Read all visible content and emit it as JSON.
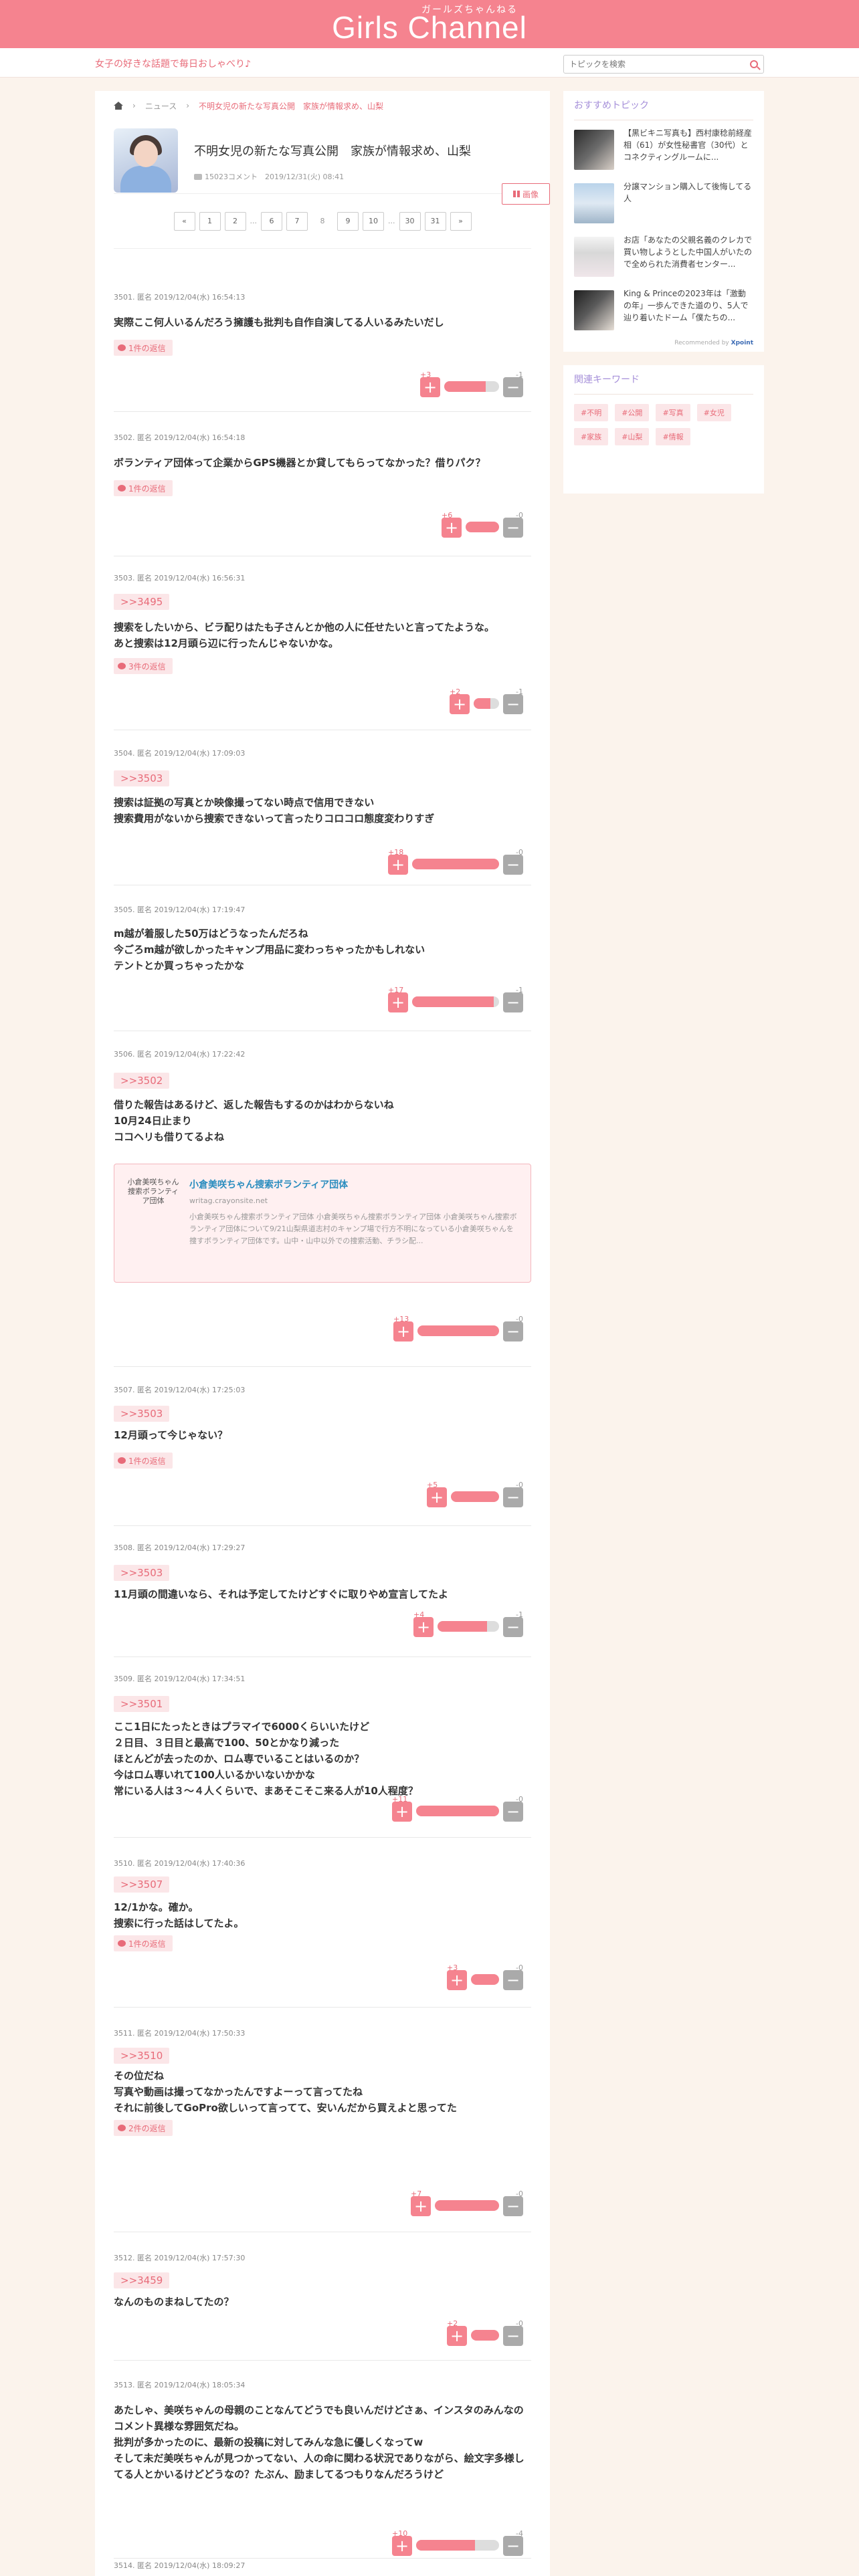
{
  "header": {
    "logo": "Girls Channel",
    "logo_sub": "ガールズちゃんねる"
  },
  "subbar": {
    "tagline": "女子の好きな話題で毎日おしゃべり♪",
    "search_placeholder": "トピックを検索"
  },
  "breadcrumb": {
    "news": "ニュース",
    "current": "不明女児の新たな写真公開　家族が情報求め、山梨"
  },
  "article": {
    "title": "不明女児の新たな写真公開　家族が情報求め、山梨",
    "comments": "15023コメント",
    "date": "2019/12/31(火) 08:41",
    "fav_label": "画像"
  },
  "pager": {
    "prev": "«",
    "next": "»",
    "pages": [
      "1",
      "2",
      "6",
      "7",
      "8",
      "9",
      "10",
      "30",
      "31"
    ],
    "dots": "..."
  },
  "comments": [
    {
      "meta": "3501. 匿名 2019/12/04(水) 16:54:13",
      "anchor": "",
      "body": "実際ここ何人いるんだろう擁護も批判も自作自演してる人いるみたいだし",
      "reply": "1件の返信",
      "plus": "+3",
      "minus": "-1",
      "ratio": 0.75
    },
    {
      "meta": "3502. 匿名 2019/12/04(水) 16:54:18",
      "anchor": "",
      "body": "ボランティア団体って企業からGPS機器とか貸してもらってなかった？借りパク？",
      "reply": "1件の返信",
      "plus": "+6",
      "minus": "-0",
      "ratio": 1
    },
    {
      "meta": "3503. 匿名 2019/12/04(水) 16:56:31",
      "anchor": ">>3495",
      "body": "捜索をしたいから、ビラ配りはたも子さんとか他の人に任せたいと言ってたような。\nあと捜索は12月頭ら辺に行ったんじゃないかな。",
      "reply": "3件の返信",
      "plus": "+2",
      "minus": "-1",
      "ratio": 0.67
    },
    {
      "meta": "3504. 匿名 2019/12/04(水) 17:09:03",
      "anchor": ">>3503",
      "body": "捜索は証拠の写真とか映像撮ってない時点で信用できない\n捜索費用がないから捜索できないって言ったりコロコロ態度変わりすぎ",
      "reply": "",
      "plus": "+18",
      "minus": "-0",
      "ratio": 1
    },
    {
      "meta": "3505. 匿名 2019/12/04(水) 17:19:47",
      "anchor": "",
      "body": "m越が着服した50万はどうなったんだろね\n今ごろm越が欲しかったキャンプ用品に変わっちゃったかもしれない\nテントとか買っちゃったかな",
      "reply": "",
      "plus": "+17",
      "minus": "-1",
      "ratio": 0.94
    },
    {
      "meta": "3506. 匿名 2019/12/04(水) 17:22:42",
      "anchor": ">>3502",
      "body": "借りた報告はあるけど、返した報告もするのかはわからないね\n10月24日止まり\nココヘリも借りてるよね",
      "reply": "",
      "plus": "+13",
      "minus": "-0",
      "ratio": 1,
      "link": {
        "thumb_alt": "小倉美咲ちゃん捜索ボランティア団体",
        "title": "小倉美咲ちゃん捜索ボランティア団体",
        "url": "writag.crayonsite.net",
        "desc": "小倉美咲ちゃん捜索ボランティア団体 小倉美咲ちゃん捜索ボランティア団体 小倉美咲ちゃん捜索ボランティア団体について9/21山梨県道志村のキャンプ場で行方不明になっている小倉美咲ちゃんを捜すボランティア団体です。山中・山中以外での捜索活動、チラシ配..."
      }
    },
    {
      "meta": "3507. 匿名 2019/12/04(水) 17:25:03",
      "anchor": ">>3503",
      "body": "12月頭って今じゃない？",
      "reply": "1件の返信",
      "plus": "+5",
      "minus": "-0",
      "ratio": 1
    },
    {
      "meta": "3508. 匿名 2019/12/04(水) 17:29:27",
      "anchor": ">>3503",
      "body": "11月頭の間違いなら、それは予定してたけどすぐに取りやめ宣言してたよ",
      "reply": "",
      "plus": "+4",
      "minus": "-1",
      "ratio": 0.8
    },
    {
      "meta": "3509. 匿名 2019/12/04(水) 17:34:51",
      "anchor": ">>3501",
      "body": "ここ1日にたったときはプラマイで6000くらいいたけど\n２日目、３日目と最高で100、50とかなり減った\nほとんどが去ったのか、ロム専でいることはいるのか？\n今はロム専いれて100人いるかいないかかな\n常にいる人は３〜４人くらいで、まあそこそこ来る人が10人程度？",
      "reply": "",
      "plus": "+11",
      "minus": "-0",
      "ratio": 1
    },
    {
      "meta": "3510. 匿名 2019/12/04(水) 17:40:36",
      "anchor": ">>3507",
      "body": "12/1かな。確か。\n捜索に行った話はしてたよ。",
      "reply": "1件の返信",
      "plus": "+3",
      "minus": "-0",
      "ratio": 1
    },
    {
      "meta": "3511. 匿名 2019/12/04(水) 17:50:33",
      "anchor": ">>3510",
      "body": "その位だね\n写真や動画は撮ってなかったんですよーって言ってたね\nそれに前後してGoPro欲しいって言ってて、安いんだから買えよと思ってた",
      "reply": "2件の返信",
      "plus": "+7",
      "minus": "-0",
      "ratio": 1
    },
    {
      "meta": "3512. 匿名 2019/12/04(水) 17:57:30",
      "anchor": ">>3459",
      "body": "なんのものまねしてたの？",
      "reply": "",
      "plus": "+2",
      "minus": "-0",
      "ratio": 1
    },
    {
      "meta": "3513. 匿名 2019/12/04(水) 18:05:34",
      "anchor": "",
      "body": "あたしゃ、美咲ちゃんの母親のことなんてどうでも良いんだけどさぁ、インスタのみんなのコメント異様な雰囲気だね。\n批判が多かったのに、最新の投稿に対してみんな急に優しくなってw\nそして未だ美咲ちゃんが見つかってない、人の命に関わる状況でありながら、絵文字多様してる人とかいるけどどうなの？たぶん、励ましてるつもりなんだろうけど",
      "reply": "",
      "plus": "+10",
      "minus": "-4",
      "ratio": 0.71
    },
    {
      "meta": "3514. 匿名 2019/12/04(水) 18:09:27",
      "anchor": "",
      "body": "",
      "reply": "",
      "plus": "",
      "minus": "",
      "ratio": 0
    }
  ],
  "sidebar": {
    "rec_title": "おすすめトピック",
    "recs": [
      {
        "text": "【黒ビキニ写真も】西村康稔前経産相（61）が女性秘書官（30代）とコネクティングルームに..."
      },
      {
        "text": "分譲マンション購入して後悔してる人"
      },
      {
        "text": "お店「あなたの父親名義のクレカで買い物しようとした中国人がいたので全められた消費者センター..."
      },
      {
        "text": "King & Princeの2023年は「激動の年」一歩んできた道のり、5人で辿り着いたドーム「僕たちの..."
      }
    ],
    "rec_by": "Recommended by",
    "rec_by_brand": "Xpoint",
    "kw_title": "関連キーワード",
    "keywords": [
      "#不明",
      "#公開",
      "#写真",
      "#女児",
      "#家族",
      "#山梨",
      "#情報"
    ]
  },
  "colors": {
    "brand": "#f5838f",
    "accent": "#e86b79",
    "side_title": "#a58fd9"
  }
}
